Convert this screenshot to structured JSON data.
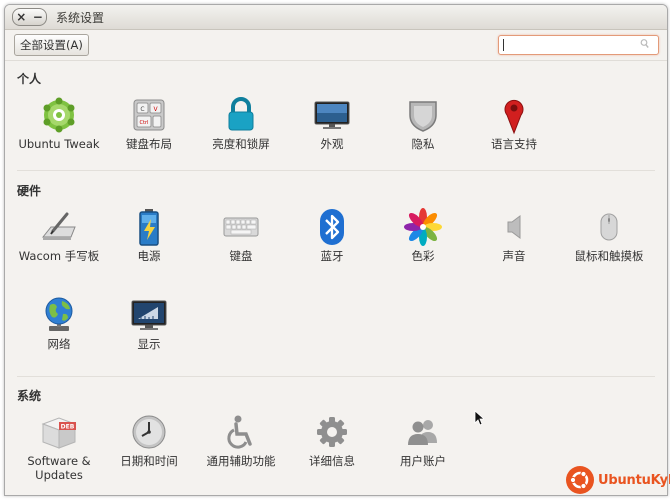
{
  "window": {
    "title": "系统设置"
  },
  "toolbar": {
    "all_settings_label": "全部设置(A)",
    "search_placeholder": ""
  },
  "sections": {
    "personal": {
      "title": "个人",
      "items": [
        {
          "label": "Ubuntu Tweak",
          "icon": "ubuntu-tweak-icon"
        },
        {
          "label": "键盘布局",
          "icon": "keyboard-layout-icon"
        },
        {
          "label": "亮度和锁屏",
          "icon": "lock-icon"
        },
        {
          "label": "外观",
          "icon": "monitor-icon"
        },
        {
          "label": "隐私",
          "icon": "shield-icon"
        },
        {
          "label": "语言支持",
          "icon": "map-pin-icon"
        }
      ]
    },
    "hardware": {
      "title": "硬件",
      "items": [
        {
          "label": "Wacom 手写板",
          "icon": "wacom-tablet-icon"
        },
        {
          "label": "电源",
          "icon": "battery-icon"
        },
        {
          "label": "键盘",
          "icon": "keyboard-icon"
        },
        {
          "label": "蓝牙",
          "icon": "bluetooth-icon"
        },
        {
          "label": "色彩",
          "icon": "color-wheel-icon"
        },
        {
          "label": "声音",
          "icon": "speaker-icon"
        },
        {
          "label": "鼠标和触摸板",
          "icon": "mouse-icon"
        },
        {
          "label": "网络",
          "icon": "globe-icon"
        },
        {
          "label": "显示",
          "icon": "display-icon"
        }
      ]
    },
    "system": {
      "title": "系统",
      "items": [
        {
          "label": "Software & Updates",
          "icon": "deb-package-icon"
        },
        {
          "label": "日期和时间",
          "icon": "clock-icon"
        },
        {
          "label": "通用辅助功能",
          "icon": "accessibility-icon"
        },
        {
          "label": "详细信息",
          "icon": "gear-icon"
        },
        {
          "label": "用户账户",
          "icon": "users-icon"
        }
      ]
    }
  },
  "branding": {
    "logo_text": "UbuntuKylin"
  },
  "colors": {
    "accent": "#e95420",
    "window_bg": "#f4f2ef"
  }
}
